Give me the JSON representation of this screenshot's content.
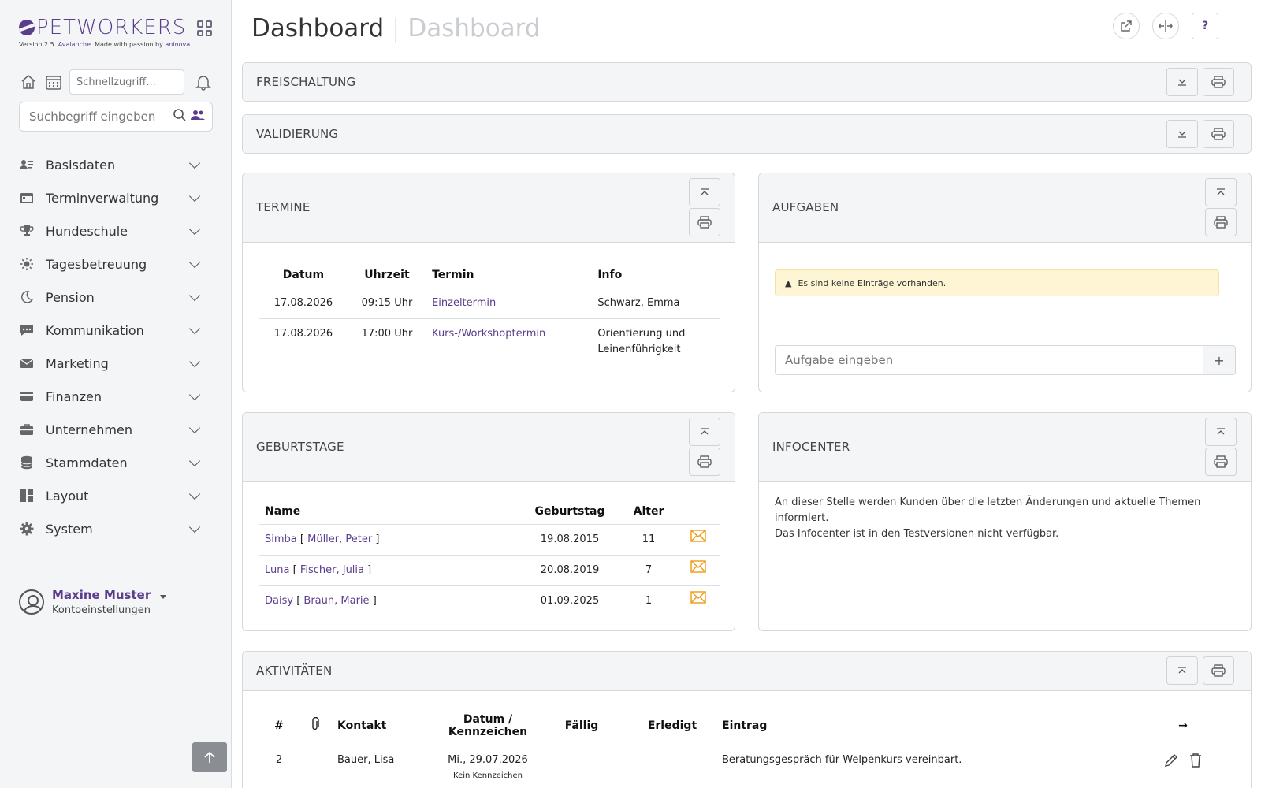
{
  "brand": {
    "name": "PETWORKERS",
    "version_prefix": "Version 2.5.",
    "version_name": "Avalanche.",
    "version_made": "Made with passion by",
    "version_by": "aninova",
    "version_dot": "."
  },
  "quick": {
    "placeholder": "Schnellzugriff..."
  },
  "search": {
    "placeholder": "Suchbegriff eingeben"
  },
  "nav": [
    {
      "label": "Basisdaten",
      "icon": "person-list-icon"
    },
    {
      "label": "Terminverwaltung",
      "icon": "calendar-icon"
    },
    {
      "label": "Hundeschule",
      "icon": "trophy-icon"
    },
    {
      "label": "Tagesbetreuung",
      "icon": "sun-icon"
    },
    {
      "label": "Pension",
      "icon": "moon-icon"
    },
    {
      "label": "Kommunikation",
      "icon": "chat-icon"
    },
    {
      "label": "Marketing",
      "icon": "envelope-icon"
    },
    {
      "label": "Finanzen",
      "icon": "credit-card-icon"
    },
    {
      "label": "Unternehmen",
      "icon": "briefcase-icon"
    },
    {
      "label": "Stammdaten",
      "icon": "database-icon"
    },
    {
      "label": "Layout",
      "icon": "layout-icon"
    },
    {
      "label": "System",
      "icon": "gear-icon"
    }
  ],
  "user": {
    "name": "Maxine Muster",
    "sub": "Kontoeinstellungen"
  },
  "header": {
    "title": "Dashboard",
    "separator": "|",
    "subtitle": "Dashboard",
    "help": "?"
  },
  "panels": {
    "freischaltung": "FREISCHALTUNG",
    "validierung": "VALIDIERUNG",
    "termine": "TERMINE",
    "aufgaben": "AUFGABEN",
    "geburtstage": "GEBURTSTAGE",
    "infocenter": "INFOCENTER",
    "aktivitaeten": "AKTIVITÄTEN"
  },
  "termine": {
    "headers": [
      "Datum",
      "Uhrzeit",
      "Termin",
      "Info"
    ],
    "rows": [
      {
        "datum": "17.08.2026",
        "uhrzeit": "09:15 Uhr",
        "termin": "Einzeltermin",
        "info": "Schwarz, Emma"
      },
      {
        "datum": "17.08.2026",
        "uhrzeit": "17:00 Uhr",
        "termin": "Kurs-/Workshoptermin",
        "info": "Orientierung und Leinenführigkeit"
      }
    ]
  },
  "aufgaben": {
    "alert": "Es sind keine Einträge vorhanden.",
    "placeholder": "Aufgabe eingeben",
    "add": "+"
  },
  "geburtstage": {
    "headers": [
      "Name",
      "Geburtstag",
      "Alter"
    ],
    "rows": [
      {
        "tier": "Simba",
        "open": "[",
        "owner": "Müller, Peter",
        "close": "]",
        "date": "19.08.2015",
        "age": "11"
      },
      {
        "tier": "Luna",
        "open": "[",
        "owner": "Fischer, Julia",
        "close": "]",
        "date": "20.08.2019",
        "age": "7"
      },
      {
        "tier": "Daisy",
        "open": "[",
        "owner": "Braun, Marie",
        "close": "]",
        "date": "01.09.2025",
        "age": "1"
      }
    ]
  },
  "infocenter": {
    "line1": "An dieser Stelle werden Kunden über die letzten Änderungen und aktuelle Themen informiert.",
    "line2": "Das Infocenter ist in den Testversionen nicht verfügbar."
  },
  "aktivitaeten": {
    "headers": {
      "num": "#",
      "kontakt": "Kontakt",
      "datum": "Datum / Kennzeichen",
      "faellig": "Fällig",
      "erledigt": "Erledigt",
      "eintrag": "Eintrag",
      "arrow": "→"
    },
    "rows": [
      {
        "num": "2",
        "kontakt": "Bauer, Lisa",
        "datum": "Mi., 29.07.2026",
        "kennzeichen": "Kein Kennzeichen",
        "faellig": "",
        "erledigt": "",
        "eintrag": "Beratungsgespräch für Welpenkurs vereinbart."
      }
    ]
  },
  "colors": {
    "accent": "#5b3d8c",
    "mail": "#f0a020",
    "alert_bg": "#fdf5d3"
  }
}
